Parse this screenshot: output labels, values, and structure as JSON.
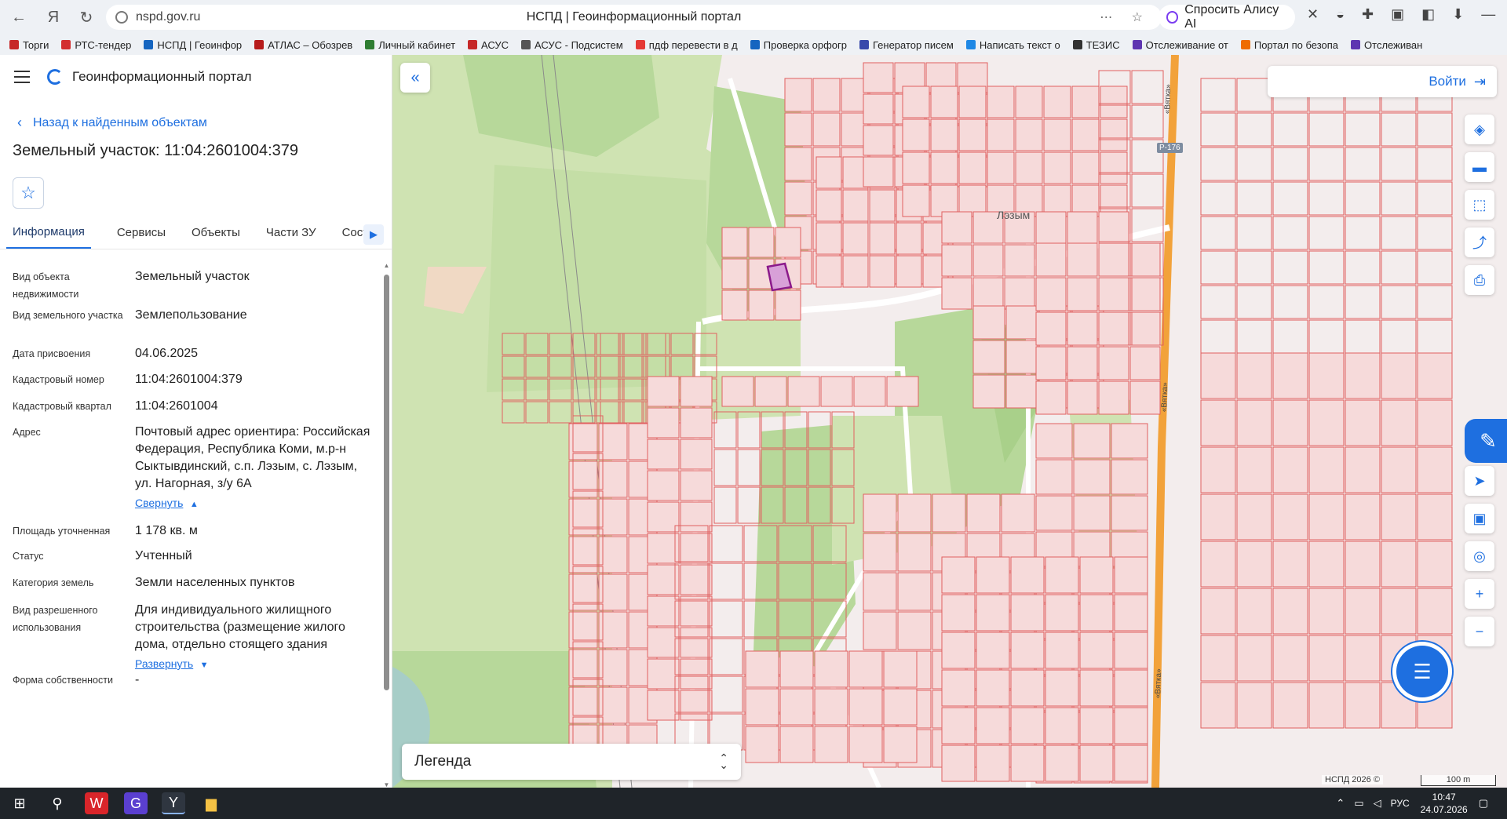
{
  "browser": {
    "url": "nspd.gov.ru",
    "page_title": "НСПД | Геоинформационный портал",
    "alice_button": "Спросить Алису AI",
    "bookmarks": [
      {
        "label": "Торги",
        "color": "#c62828"
      },
      {
        "label": "РТС-тендер",
        "color": "#d32f2f"
      },
      {
        "label": "НСПД | Геоинфор",
        "color": "#1565c0"
      },
      {
        "label": "АТЛАС – Обозрев",
        "color": "#b71c1c"
      },
      {
        "label": "Личный кабинет",
        "color": "#2e7d32"
      },
      {
        "label": "АСУС",
        "color": "#c62828"
      },
      {
        "label": "АСУС - Подсистем",
        "color": "#555555"
      },
      {
        "label": "пдф перевести в д",
        "color": "#e53935"
      },
      {
        "label": "Проверка орфогр",
        "color": "#1565c0"
      },
      {
        "label": "Генератор писем",
        "color": "#3949ab"
      },
      {
        "label": "Написать текст о",
        "color": "#1e88e5"
      },
      {
        "label": "ТЕЗИС",
        "color": "#333333"
      },
      {
        "label": "Отслеживание от",
        "color": "#5e35b1"
      },
      {
        "label": "Портал по безопа",
        "color": "#ef6c00"
      },
      {
        "label": "Отслеживан",
        "color": "#5e35b1"
      }
    ]
  },
  "panel": {
    "portal_name": "Геоинформационный портал",
    "back_link": "Назад к найденным объектам",
    "object_title": "Земельный участок: 11:04:2601004:379",
    "tabs": [
      "Информация",
      "Сервисы",
      "Объекты",
      "Части ЗУ",
      "Состав"
    ],
    "properties": [
      {
        "key": "Вид объекта недвижимости",
        "value": "Земельный участок"
      },
      {
        "key": "Вид земельного участка",
        "value": "Землепользование"
      },
      {
        "key": "Дата присвоения",
        "value": "04.06.2025"
      },
      {
        "key": "Кадастровый номер",
        "value": "11:04:2601004:379"
      },
      {
        "key": "Кадастровый квартал",
        "value": "11:04:2601004"
      },
      {
        "key": "Адрес",
        "value": "Почтовый адрес ориентира: Российская Федерация, Республика Коми, м.р-н Сыктывдинский, с.п. Лэзым, с. Лэзым, ул. Нагорная, з/у 6А",
        "link": "Свернуть"
      },
      {
        "key": "Площадь уточненная",
        "value": "1 178 кв. м"
      },
      {
        "key": "Статус",
        "value": "Учтенный"
      },
      {
        "key": "Категория земель",
        "value": "Земли населенных пунктов"
      },
      {
        "key": "Вид разрешенного использования",
        "value": "Для индивидуального жилищного строительства (размещение жилого дома, отдельно стоящего здания",
        "link": "Развернуть"
      },
      {
        "key": "Форма собственности",
        "value": "-"
      }
    ]
  },
  "map": {
    "login_button": "Войти",
    "legend_label": "Легенда",
    "attribution": "НСПД 2026 ©",
    "scale_label": "100 m",
    "place_label": "Лэзым",
    "road_badge": "Р-176",
    "road_name_top": "«Вятка»",
    "road_name_mid": "«Вятка»",
    "road_name_bottom": "«Вятка»",
    "colors": {
      "parcel_fill": "#f6dada",
      "parcel_stroke": "#e06060",
      "selected_stroke": "#8b1a8b",
      "forest": "#b7d89a",
      "meadow": "#cfe3b2",
      "highway": "#f2a23a",
      "accent": "#1e6fe0"
    }
  },
  "taskbar": {
    "lang": "РУС",
    "time": "10:47",
    "date": "24.07.2026"
  }
}
